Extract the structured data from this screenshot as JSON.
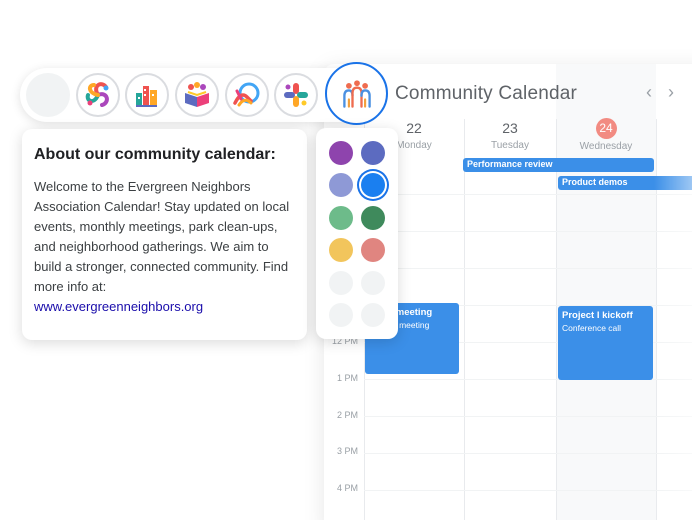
{
  "calendar": {
    "title": "Community Calendar",
    "prev_icon": "chevron-left-icon",
    "next_icon": "chevron-right-icon",
    "days": [
      {
        "num": "22",
        "name": "Monday",
        "today": false
      },
      {
        "num": "23",
        "name": "Tuesday",
        "today": false
      },
      {
        "num": "24",
        "name": "Wednesday",
        "today": true
      }
    ],
    "times": [
      "12 PM",
      "1 PM",
      "2 PM",
      "3 PM",
      "4 PM"
    ],
    "all_day_events": [
      {
        "title": "Performance review"
      },
      {
        "title": "Product demos"
      }
    ],
    "events": [
      {
        "title": "Team meeting",
        "subtitle": "Weekly meeting"
      },
      {
        "title": "Project I kickoff",
        "subtitle": "Conference call"
      }
    ]
  },
  "toolbar": {
    "logos": [
      {
        "name": "blank-logo-option"
      },
      {
        "name": "swirl-people-logo"
      },
      {
        "name": "city-mosaic-logo"
      },
      {
        "name": "open-book-logo"
      },
      {
        "name": "hands-logo"
      },
      {
        "name": "puzzle-cross-logo"
      },
      {
        "name": "three-people-logo",
        "selected": true
      }
    ]
  },
  "about": {
    "title": "About our community calendar:",
    "body": "Welcome to the Evergreen Neighbors Association Calendar! Stay updated on local events, monthly meetings, park clean-ups, and neighborhood gatherings. We aim to build a stronger, connected community. Find more info at:",
    "link": "www.evergreenneighbors.org"
  },
  "palette": {
    "colors": [
      "#8e44ad",
      "#5c6bc0",
      "#8e99d6",
      "#1a7ff0",
      "#6dbb8a",
      "#3f8a5c",
      "#f2c55c",
      "#e08580",
      "#f1f3f4",
      "#f1f3f4",
      "#f1f3f4",
      "#f1f3f4"
    ],
    "selected_index": 3,
    "accent": "#1a73e8"
  }
}
